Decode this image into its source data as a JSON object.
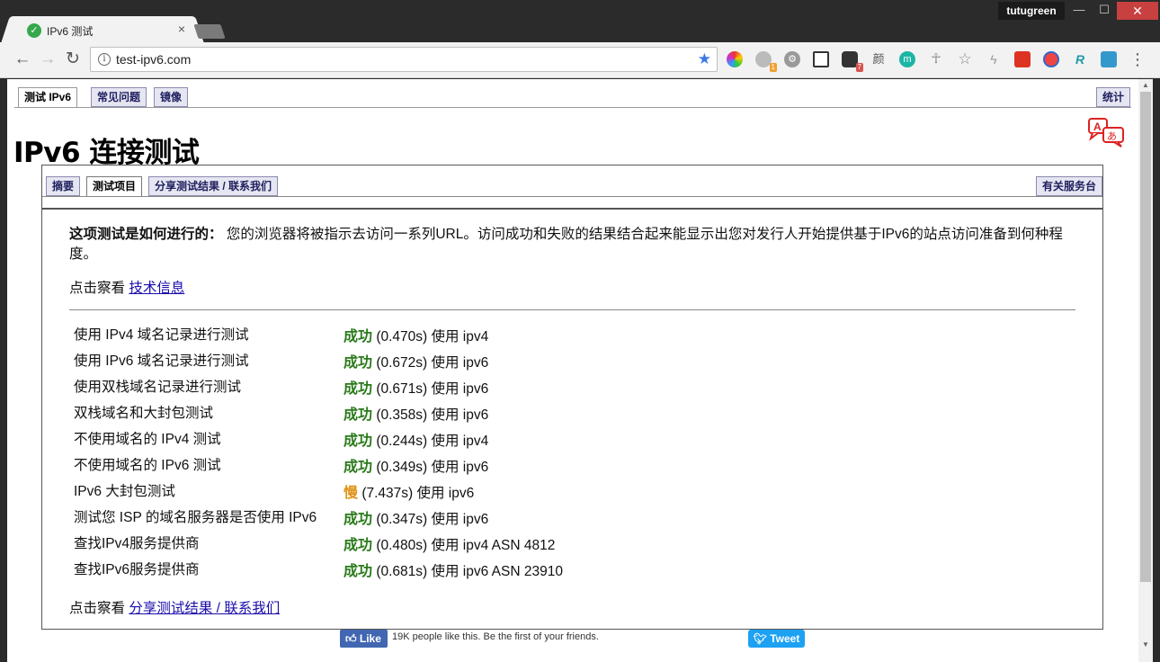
{
  "browser": {
    "tab_title": "IPv6 测试",
    "tab_close": "×",
    "user_name": "tutugreen",
    "window_min": "—",
    "window_max": "☐",
    "window_close": "✕",
    "url": "test-ipv6.com",
    "nav_back": "←",
    "nav_forward": "→",
    "nav_reload": "↻",
    "star": "★",
    "menu": "⋮",
    "extension_badges": {
      "ext2": "1",
      "ext5": "7"
    },
    "extension_icon_names": [
      "colorwheel-extension-icon",
      "search-extension-icon",
      "gear-extension-icon",
      "qr-code-extension-icon",
      "ghost-extension-icon",
      "text-extension-icon",
      "m-extension-icon",
      "ankh-extension-icon",
      "star-outline-icon",
      "bolt-extension-icon",
      "red-extension-icon",
      "shield-extension-icon",
      "r-extension-icon",
      "translate-extension-icon"
    ],
    "extension_text": {
      "ext6": "颜",
      "ext7": "m",
      "ext13": "R"
    }
  },
  "site_tabs": {
    "test": "测试 IPv6",
    "faq": "常见问题",
    "mirrors": "镜像",
    "stats": "统计"
  },
  "page": {
    "heading": "IPv6 连接测试"
  },
  "sub_tabs": {
    "summary": "摘要",
    "tests": "测试项目",
    "share": "分享测试结果 / 联系我们",
    "helpdesk": "有关服务台"
  },
  "intro": {
    "bold": "这项测试是如何进行的：",
    "text": " 您的浏览器将被指示去访问一系列URL。访问成功和失败的结果结合起来能显示出您对发行人开始提供基于IPv6的站点访问准备到何种程度。"
  },
  "tech": {
    "prefix": "点击察看 ",
    "link": "技术信息"
  },
  "tests": [
    {
      "label": "使用 IPv4 域名记录进行测试",
      "status": "成功",
      "detail": " (0.470s) 使用 ipv4"
    },
    {
      "label": "使用 IPv6 域名记录进行测试",
      "status": "成功",
      "detail": " (0.672s) 使用 ipv6"
    },
    {
      "label": "使用双栈域名记录进行测试",
      "status": "成功",
      "detail": " (0.671s) 使用 ipv6"
    },
    {
      "label": "双栈域名和大封包测试",
      "status": "成功",
      "detail": " (0.358s) 使用 ipv6"
    },
    {
      "label": "不使用域名的 IPv4 测试",
      "status": "成功",
      "detail": " (0.244s) 使用 ipv4"
    },
    {
      "label": "不使用域名的 IPv6 测试",
      "status": "成功",
      "detail": " (0.349s) 使用 ipv6"
    },
    {
      "label": "IPv6 大封包测试",
      "status": "慢",
      "detail": " (7.437s) 使用 ipv6"
    },
    {
      "label": "测试您 ISP 的域名服务器是否使用 IPv6",
      "status": "成功",
      "detail": " (0.347s) 使用 ipv6"
    },
    {
      "label": "查找IPv4服务提供商",
      "status": "成功",
      "detail": " (0.480s) 使用 ipv4 ASN 4812"
    },
    {
      "label": "查找IPv6服务提供商",
      "status": "成功",
      "detail": " (0.681s) 使用 ipv6 ASN 23910"
    }
  ],
  "share": {
    "prefix": "点击察看 ",
    "link": "分享测试结果 / 联系我们"
  },
  "social": {
    "like": "Like",
    "like_text": "19K people like this. Be the first of your friends.",
    "tweet": "Tweet"
  },
  "colors": {
    "success": "#2a7a1a",
    "slow": "#e0931a",
    "link": "#1a0dab"
  }
}
